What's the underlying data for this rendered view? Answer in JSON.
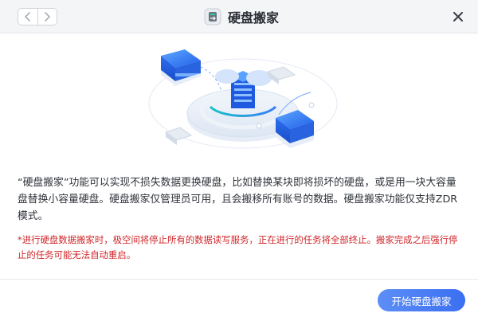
{
  "window": {
    "title": "硬盘搬家",
    "app_icon": "hard-disk-migration-icon"
  },
  "nav": {
    "back_icon": "chevron-left-icon",
    "forward_icon": "chevron-right-icon",
    "close_icon": "close-icon"
  },
  "content": {
    "description": "“硬盘搬家”功能可以实现不损失数据更换硬盘，比如替换某块即将损坏的硬盘，或是用一块大容量盘替换小容量硬盘。硬盘搬家仅管理员可用，且会搬移所有账号的数据。硬盘搬家功能仅支持ZDR模式。",
    "warning": "*进行硬盘数据搬家时，极空间将停止所有的数据读写服务，正在进行的任务将全部终止。搬家完成之后强行停止的任务可能无法自动重启。"
  },
  "footer": {
    "start_button_label": "开始硬盘搬家"
  },
  "colors": {
    "accent": "#3a6ff2",
    "warning": "#d0272b"
  }
}
